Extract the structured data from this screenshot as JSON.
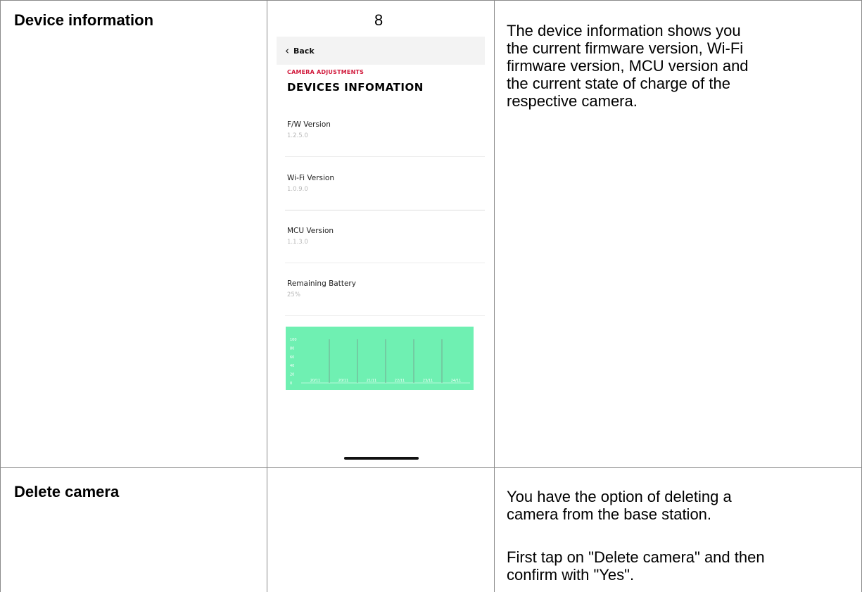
{
  "rows": [
    {
      "label": "Device information",
      "page_number": "8",
      "description_lines": [
        "The device information shows you",
        "the current firmware version, Wi-Fi",
        "firmware version, MCU version and",
        "the current state of charge of the",
        "respective camera."
      ]
    },
    {
      "label": "Delete camera",
      "description_paragraph1_lines": [
        "You have the option of deleting a",
        "camera from the base station."
      ],
      "description_paragraph2_lines": [
        "First tap on \"Delete camera\" and then",
        "confirm with \"Yes\"."
      ]
    }
  ],
  "phone": {
    "back_label": "Back",
    "section_label": "CAMERA ADJUSTMENTS",
    "title": "DEVICES INFOMATION",
    "items": [
      {
        "label": "F/W Version",
        "value": "1.2.5.0"
      },
      {
        "label": "Wi-Fi Version",
        "value": "1.0.9.0"
      },
      {
        "label": "MCU Version",
        "value": "1.1.3.0"
      },
      {
        "label": "Remaining Battery",
        "value": "25%"
      }
    ],
    "chart_background": "#6ff0b2",
    "accent_color": "#d11a3c"
  },
  "chart_data": {
    "type": "line",
    "categories": [
      "20/11",
      "20/11",
      "21/11",
      "22/11",
      "23/11",
      "24/11"
    ],
    "yticks": [
      0,
      20,
      40,
      60,
      80,
      100
    ],
    "ylim": [
      0,
      100
    ],
    "series": [],
    "grid": true
  }
}
